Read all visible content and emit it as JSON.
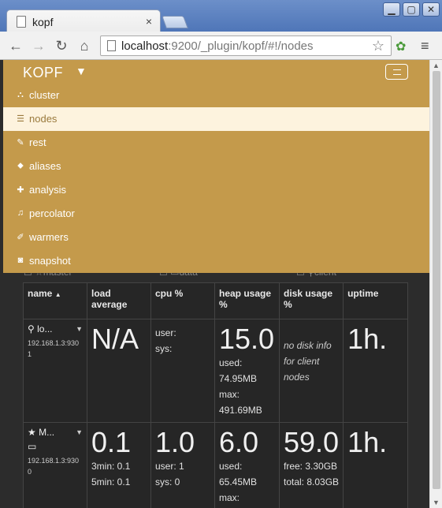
{
  "browser": {
    "tab_title": "kopf",
    "tab_close": "×",
    "url_host": "localhost",
    "url_rest": ":9200/_plugin/kopf/#!/nodes",
    "window_minimize": "▁",
    "window_maximize": "▢",
    "window_close": "✕"
  },
  "navbar": {
    "brand": "KOPF",
    "items": [
      {
        "label": "cluster",
        "icon": "sitemap-icon",
        "glyph": "⛬"
      },
      {
        "label": "nodes",
        "icon": "server-icon",
        "glyph": "☰",
        "active": true
      },
      {
        "label": "rest",
        "icon": "edit-icon",
        "glyph": "✎"
      },
      {
        "label": "aliases",
        "icon": "tags-icon",
        "glyph": "⬥"
      },
      {
        "label": "analysis",
        "icon": "puzzle-icon",
        "glyph": "✚"
      },
      {
        "label": "percolator",
        "icon": "bell-icon",
        "glyph": "♫"
      },
      {
        "label": "warmers",
        "icon": "fire-icon",
        "glyph": "✐"
      },
      {
        "label": "snapshot",
        "icon": "camera-icon",
        "glyph": "◙"
      }
    ]
  },
  "filters": {
    "master": "master",
    "data": "data",
    "client": "client"
  },
  "table": {
    "headers": {
      "name": "name",
      "load": "load average",
      "cpu": "cpu %",
      "heap": "heap usage %",
      "disk": "disk usage %",
      "uptime": "uptime"
    },
    "rows": [
      {
        "name": "lo...",
        "ip_line1": "192.168.1.3:930",
        "ip_line2": "1",
        "load_big": "N/A",
        "load_3min": "",
        "load_5min": "",
        "cpu_big": "",
        "cpu_user": "user:",
        "cpu_sys": "sys:",
        "heap_big": "15.0",
        "heap_used_label": "used:",
        "heap_used": "74.95MB",
        "heap_max_label": "max:",
        "heap_max": "491.69MB",
        "disk_big": "",
        "disk_note": "no disk info for client nodes",
        "disk_free": "",
        "disk_total": "",
        "uptime": "1h."
      },
      {
        "name": "M...",
        "ip_line1": "192.168.1.3:930",
        "ip_line2": "0",
        "load_big": "0.1",
        "load_3min": "3min: 0.1",
        "load_5min": "5min: 0.1",
        "cpu_big": "1.0",
        "cpu_user": "user: 1",
        "cpu_sys": "sys: 0",
        "heap_big": "6.0",
        "heap_used_label": "used:",
        "heap_used": "65.45MB",
        "heap_max_label": "max:",
        "heap_max": "",
        "disk_big": "59.0",
        "disk_note": "",
        "disk_free": "free: 3.30GB",
        "disk_total": "total: 8.03GB",
        "uptime": "1h."
      }
    ]
  }
}
